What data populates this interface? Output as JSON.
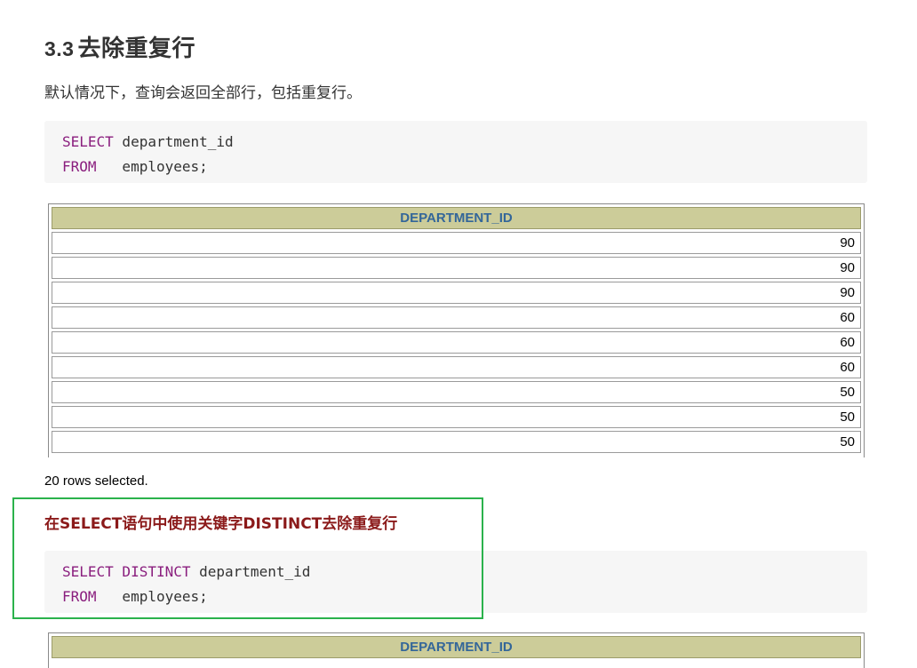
{
  "section": {
    "number": "3.3",
    "title": "去除重复行"
  },
  "intro": "默认情况下，查询会返回全部行，包括重复行。",
  "code1": {
    "line1_kw": "SELECT",
    "line1_rest": " department_id",
    "line2_kw": "FROM",
    "line2_rest": "   employees;"
  },
  "result1": {
    "header": "DEPARTMENT_ID",
    "rows": [
      "90",
      "90",
      "90",
      "60",
      "60",
      "60",
      "50",
      "50",
      "50"
    ]
  },
  "status": "20 rows selected.",
  "callout": "在SELECT语句中使用关键字DISTINCT去除重复行",
  "code2": {
    "line1_kw1": "SELECT",
    "line1_kw2": " DISTINCT",
    "line1_rest": " department_id",
    "line2_kw": "FROM",
    "line2_rest": "   employees;"
  },
  "result2": {
    "header": "DEPARTMENT_ID"
  },
  "colors": {
    "header_bg": "#cccc99",
    "header_text": "#336699",
    "keyword": "#8a1e7e",
    "callout": "#8b1a1a",
    "highlight_border": "#2bb24c"
  }
}
